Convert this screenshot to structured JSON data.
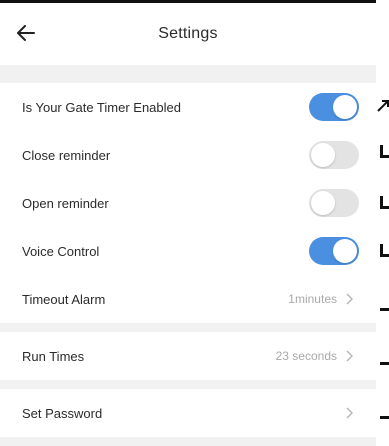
{
  "header": {
    "title": "Settings"
  },
  "settings": {
    "gate_timer": {
      "label": "Is Your Gate Timer Enabled",
      "enabled": true
    },
    "close_reminder": {
      "label": "Close reminder",
      "enabled": false
    },
    "open_reminder": {
      "label": "Open reminder",
      "enabled": false
    },
    "voice_control": {
      "label": "Voice Control",
      "enabled": true
    },
    "timeout_alarm": {
      "label": "Timeout Alarm",
      "value": "1minutes"
    },
    "run_times": {
      "label": "Run Times",
      "value": "23 seconds"
    },
    "set_password": {
      "label": "Set Password"
    }
  },
  "colors": {
    "toggle_on": "#4a8fe0",
    "toggle_off": "#e3e3e3",
    "divider": "#f1f1f1"
  },
  "icons": {
    "back": "arrow-left-icon",
    "chevron": "chevron-right-icon"
  }
}
